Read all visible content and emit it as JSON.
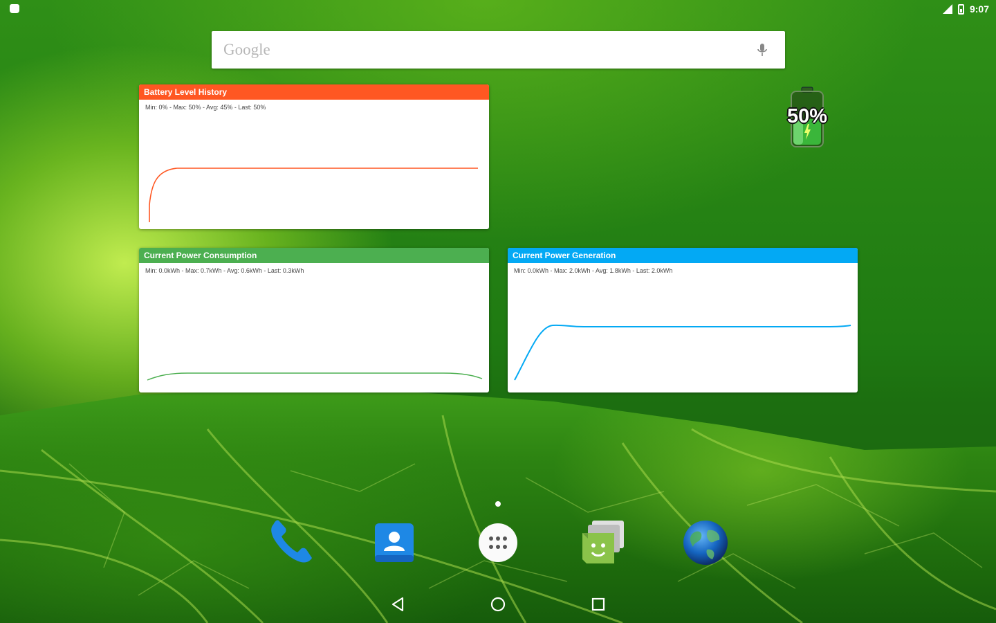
{
  "status_bar": {
    "time": "9:07",
    "left_icon": "android-icon",
    "signal_icon": "signal-icon",
    "battery_icon": "battery-icon"
  },
  "search": {
    "logo_text": "Google",
    "mic_icon": "mic-icon"
  },
  "widgets": {
    "battery_history": {
      "title": "Battery Level History",
      "stats": "Min: 0% - Max: 50% - Avg: 45% - Last: 50%",
      "color": "#FF5722"
    },
    "power_consumption": {
      "title": "Current Power Consumption",
      "stats": "Min: 0.0kWh - Max: 0.7kWh - Avg: 0.6kWh - Last: 0.3kWh",
      "color": "#4CAF50"
    },
    "power_generation": {
      "title": "Current Power Generation",
      "stats": "Min: 0.0kWh - Max: 2.0kWh - Avg: 1.8kWh - Last: 2.0kWh",
      "color": "#03A9F4"
    }
  },
  "battery_widget": {
    "percent_text": "50%",
    "level": 0.5
  },
  "dock": {
    "icons": [
      "phone-icon",
      "contacts-icon",
      "app-drawer-icon",
      "messaging-icon",
      "browser-icon"
    ]
  },
  "nav": {
    "icons": [
      "back-icon",
      "home-icon",
      "recents-icon"
    ]
  }
}
